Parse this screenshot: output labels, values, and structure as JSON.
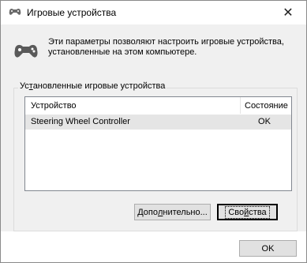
{
  "window": {
    "title": "Игровые устройства",
    "close_glyph": "✕"
  },
  "description": "Эти параметры позволяют настроить игровые устройства, установленные на этом компьютере.",
  "group": {
    "title_pre": "Ус",
    "title_accel": "т",
    "title_post": "ановленные игровые устройства"
  },
  "list": {
    "columns": [
      "Устройство",
      "Состояние"
    ],
    "rows": [
      {
        "device": "Steering Wheel Controller",
        "state": "OK"
      }
    ]
  },
  "buttons": {
    "advanced_pre": "Допо",
    "advanced_accel": "л",
    "advanced_post": "нительно...",
    "properties_pre": "Сво",
    "properties_accel": "й",
    "properties_post": "ства",
    "ok": "OK"
  },
  "colors": {
    "window_bg": "#f0f0f0",
    "selected_row": "#e5e5e5",
    "button_bg": "#e1e1e1",
    "border": "#adadad"
  },
  "icons": {
    "title": "gamepad-icon",
    "dialog": "gamepad-icon"
  }
}
